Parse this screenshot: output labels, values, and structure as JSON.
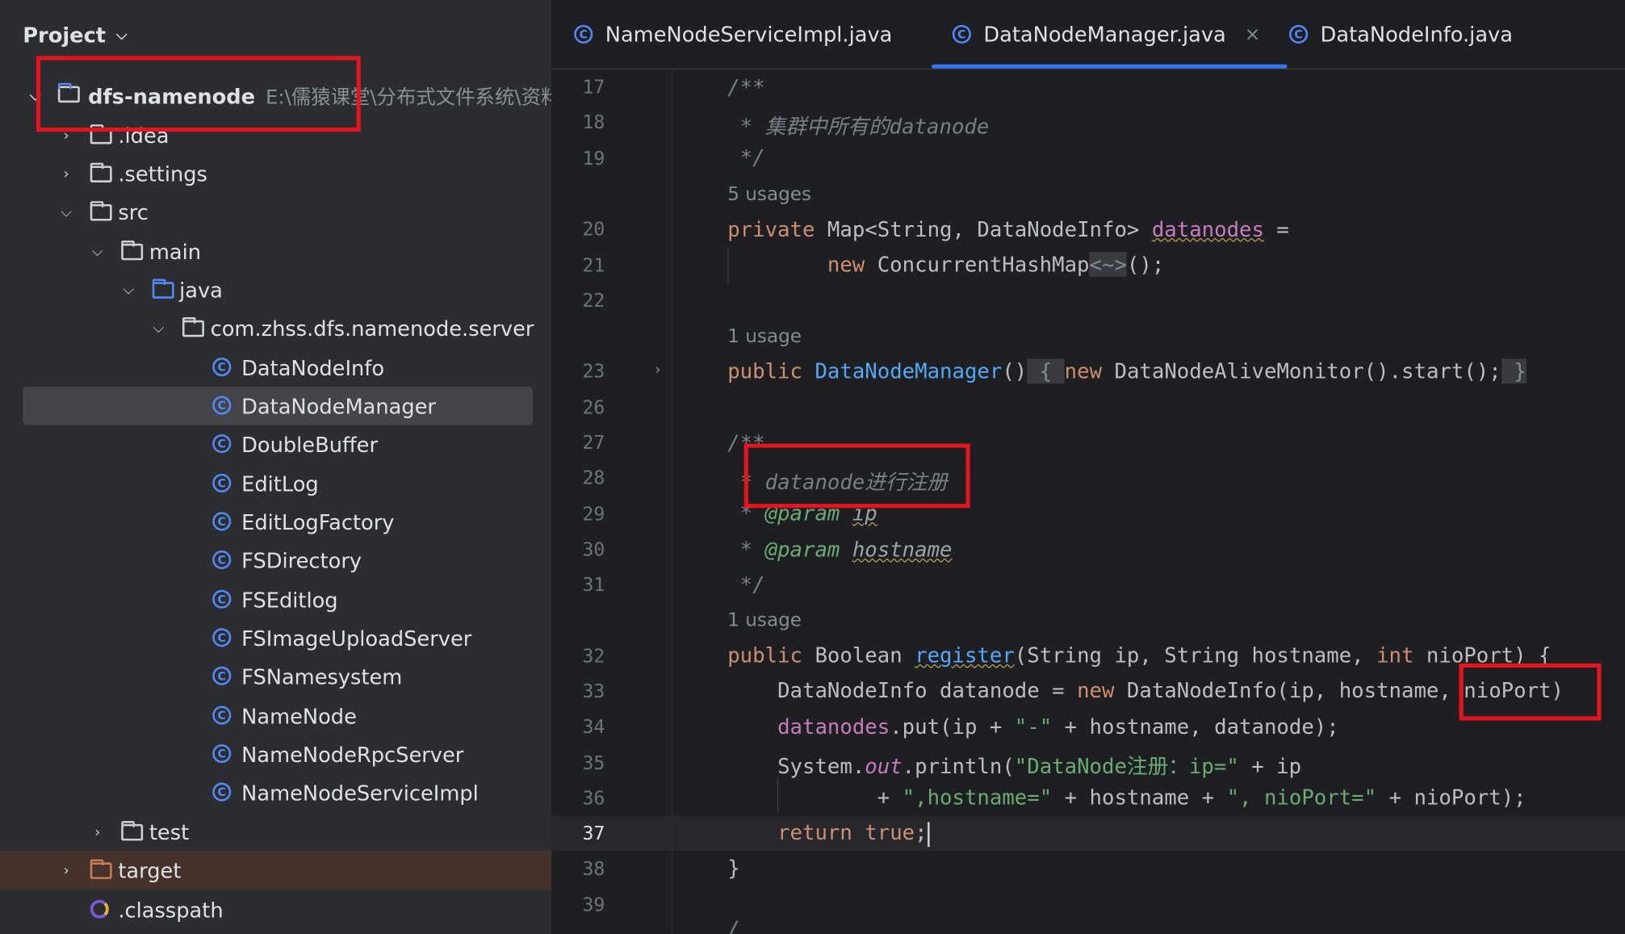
{
  "project_panel": {
    "title": "Project",
    "root": {
      "name": "dfs-namenode",
      "path": "E:\\儒猿课堂\\分布式文件系统\\资料"
    },
    "items": [
      {
        "label": ".idea"
      },
      {
        "label": ".settings"
      },
      {
        "label": "src"
      },
      {
        "label": "main"
      },
      {
        "label": "java"
      },
      {
        "label": "com.zhss.dfs.namenode.server"
      },
      {
        "label": "DataNodeInfo"
      },
      {
        "label": "DataNodeManager"
      },
      {
        "label": "DoubleBuffer"
      },
      {
        "label": "EditLog"
      },
      {
        "label": "EditLogFactory"
      },
      {
        "label": "FSDirectory"
      },
      {
        "label": "FSEditlog"
      },
      {
        "label": "FSImageUploadServer"
      },
      {
        "label": "FSNamesystem"
      },
      {
        "label": "NameNode"
      },
      {
        "label": "NameNodeRpcServer"
      },
      {
        "label": "NameNodeServiceImpl"
      },
      {
        "label": "test"
      },
      {
        "label": "target"
      },
      {
        "label": ".classpath"
      }
    ],
    "selected": "DataNodeManager"
  },
  "tabs": [
    {
      "label": "NameNodeServiceImpl.java",
      "active": false
    },
    {
      "label": "DataNodeManager.java",
      "active": true,
      "close": "×"
    },
    {
      "label": "DataNodeInfo.java",
      "active": false
    }
  ],
  "editor": {
    "current_line": "37",
    "line_numbers": [
      "17",
      "18",
      "19",
      "20",
      "21",
      "22",
      "23",
      "26",
      "27",
      "28",
      "29",
      "30",
      "31",
      "32",
      "33",
      "34",
      "35",
      "36",
      "37",
      "38",
      "39"
    ],
    "hints": {
      "h1": "5 usages",
      "h2": "1 usage",
      "h3": "1 usage"
    },
    "code": {
      "l17": "/**",
      "l18_star": " * ",
      "l18_text": "集群中所有的datanode",
      "l19": " */",
      "l20_kw": "private",
      "l20_type": " Map<String, DataNodeInfo> ",
      "l20_field": "datanodes",
      "l20_rest": " =",
      "l21_kw": "new",
      "l21_type": " ConcurrentHashMap",
      "l21_fold": "<~>",
      "l21_rest": "();",
      "l23_kw": "public",
      "l23_fn": "DataNodeManager",
      "l23_paren": "()",
      "l23_open": "{",
      "l23_kw2": "new",
      "l23_body": " DataNodeAliveMonitor().start();",
      "l23_close": "}",
      "l27": "/**",
      "l28_star": " * ",
      "l28_text": "datanode进行注册",
      "l29_star": " * ",
      "l29_tag": "@param",
      "l29_name": "ip",
      "l30_star": " * ",
      "l30_tag": "@param",
      "l30_name": "hostname",
      "l31": " */",
      "l32_kw": "public",
      "l32_type": " Boolean ",
      "l32_fn": "register",
      "l32_args": "(String ip, String hostname, ",
      "l32_int": "int",
      "l32_rest": " nioPort) {",
      "l33_a": "DataNodeInfo datanode = ",
      "l33_kw": "new",
      "l33_b": " DataNodeInfo(ip, hostname, nioPort)",
      "l34_field": "datanodes",
      "l34_a": ".put(ip + ",
      "l34_str": "\"-\"",
      "l34_b": " + hostname, datanode);",
      "l35_a": "System.",
      "l35_out": "out",
      "l35_b": ".println(",
      "l35_str": "\"DataNode注册：ip=\"",
      "l35_c": " + ip",
      "l36_a": "+ ",
      "l36_str1": "\",hostname=\"",
      "l36_b": " + hostname + ",
      "l36_str2": "\", nioPort=\"",
      "l36_c": " + nioPort);",
      "l37_kw": "return",
      "l37_kw2": "true",
      "l37_semi": ";",
      "l38": "}",
      "l39": "/"
    }
  },
  "colors": {
    "annotation_box": "#e5141f",
    "tab_underline": "#3574f0",
    "keyword": "#cf8e6d",
    "field": "#c77dbb",
    "method": "#56a8f5",
    "string": "#6aab73",
    "comment": "#7a7e85"
  }
}
